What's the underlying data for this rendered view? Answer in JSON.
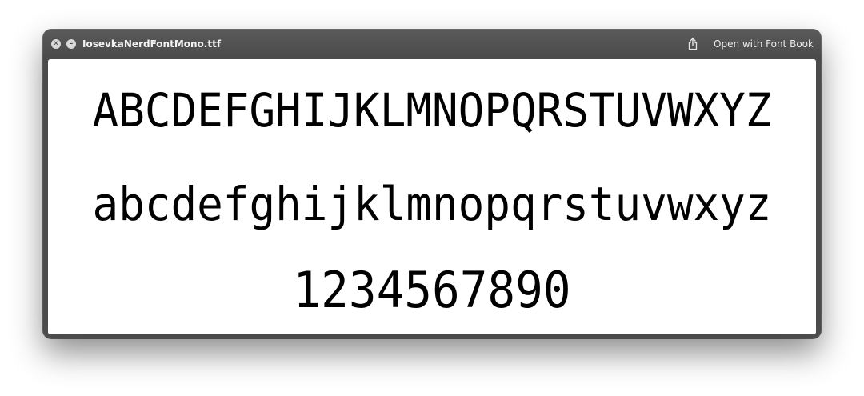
{
  "window": {
    "title": "IosevkaNerdFontMono.ttf",
    "close_glyph": "✕",
    "min_glyph": "–",
    "open_button_label": "Open with Font Book"
  },
  "icons": {
    "close": "close-icon",
    "minimize": "minimize-icon",
    "share": "share-icon"
  },
  "preview": {
    "uppercase": "ABCDEFGHIJKLMNOPQRSTUVWXYZ",
    "lowercase": "abcdefghijklmnopqrstuvwxyz",
    "digits": "1234567890"
  },
  "colors": {
    "titlebar": "#4b4b4b",
    "content_bg": "#ffffff",
    "text": "#000000"
  }
}
